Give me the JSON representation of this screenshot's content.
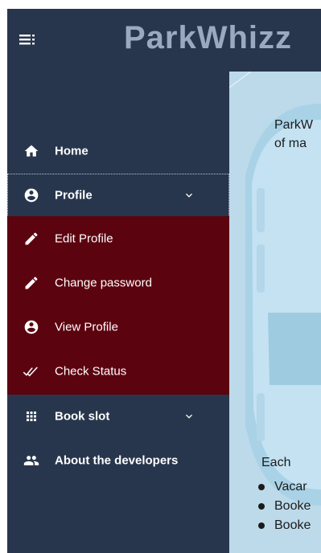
{
  "header": {
    "brand": "ParkWhizz"
  },
  "sidebar": {
    "items": [
      {
        "label": "Home",
        "icon": "home-icon"
      },
      {
        "label": "Profile",
        "icon": "account-circle-icon",
        "expanded": true
      },
      {
        "label": "Book slot",
        "icon": "grid-icon",
        "expanded": false
      },
      {
        "label": "About the developers",
        "icon": "group-icon"
      }
    ],
    "profile_submenu": [
      {
        "label": "Edit Profile",
        "icon": "pencil-icon"
      },
      {
        "label": "Change password",
        "icon": "pencil-icon"
      },
      {
        "label": "View Profile",
        "icon": "account-circle-icon"
      },
      {
        "label": "Check Status",
        "icon": "double-check-icon"
      }
    ]
  },
  "main": {
    "intro_line1": "ParkW",
    "intro_line2": "of ma",
    "list_intro": "Each",
    "bullets": [
      "Vacar",
      "Booke",
      "Booke"
    ]
  },
  "colors": {
    "header_bg": "#28364d",
    "brand_text": "#9aa9bf",
    "submenu_bg": "#5c0310",
    "main_bg": "#bddaea"
  }
}
